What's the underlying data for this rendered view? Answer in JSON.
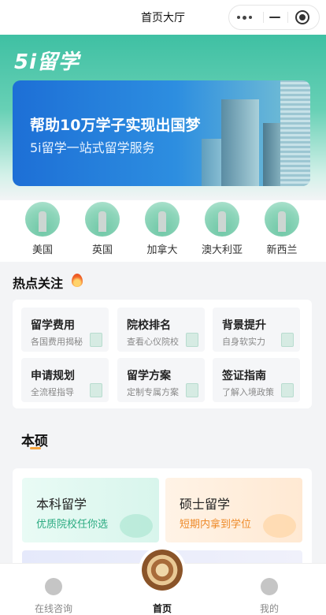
{
  "navbar": {
    "title": "首页大厅",
    "more_icon": "more-dots-icon",
    "minimize_icon": "minus-icon",
    "close_icon": "target-circle-icon"
  },
  "hero": {
    "logo": "5i留学",
    "banner_title": "帮助10万学子实现出国梦",
    "banner_subtitle": "5i留学一站式留学服务"
  },
  "countries": [
    {
      "label": "美国"
    },
    {
      "label": "英国"
    },
    {
      "label": "加拿大"
    },
    {
      "label": "澳大利亚"
    },
    {
      "label": "新西兰"
    }
  ],
  "hot": {
    "title": "热点关注",
    "cards": [
      {
        "title": "留学费用",
        "subtitle": "各国费用揭秘"
      },
      {
        "title": "院校排名",
        "subtitle": "查看心仪院校"
      },
      {
        "title": "背景提升",
        "subtitle": "自身软实力"
      },
      {
        "title": "申请规划",
        "subtitle": "全流程指导"
      },
      {
        "title": "留学方案",
        "subtitle": "定制专属方案"
      },
      {
        "title": "签证指南",
        "subtitle": "了解入境政策"
      }
    ]
  },
  "section": {
    "title": "本硕",
    "cards": [
      {
        "title": "本科留学",
        "subtitle": "优质院校任你选"
      },
      {
        "title": "硕士留学",
        "subtitle": "短期内拿到学位"
      }
    ]
  },
  "tabbar": {
    "items": [
      {
        "label": "在线咨询"
      },
      {
        "label": "首页"
      },
      {
        "label": "我的"
      }
    ]
  },
  "colors": {
    "brand": "#3fc0a3",
    "accent_orange": "#f4a23c",
    "banner_blue": "#1d6fd6"
  }
}
